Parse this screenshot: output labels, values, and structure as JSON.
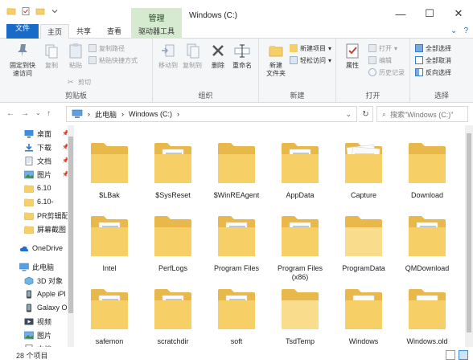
{
  "window": {
    "title": "Windows (C:)",
    "context_tab_title": "管理",
    "controls": {
      "minimize": "—",
      "maximize": "☐",
      "close": "✕"
    }
  },
  "ribbon_tabs": [
    {
      "label": "文件"
    },
    {
      "label": "主页"
    },
    {
      "label": "共享"
    },
    {
      "label": "查看"
    },
    {
      "label": "驱动器工具"
    }
  ],
  "ribbon": {
    "clipboard": {
      "label": "剪贴板",
      "pin_quick": "固定到快\n速访问",
      "copy": "复制",
      "paste": "粘贴",
      "copy_path": "复制路径",
      "paste_shortcut": "粘贴快捷方式",
      "cut": "剪切"
    },
    "organize": {
      "label": "组织",
      "move_to": "移动到",
      "copy_to": "复制到",
      "delete": "删除",
      "rename": "重命名"
    },
    "new": {
      "label": "新建",
      "new_folder": "新建\n文件夹",
      "new_item": "新建项目",
      "easy_access": "轻松访问"
    },
    "open": {
      "label": "打开",
      "properties": "属性",
      "open": "打开",
      "edit": "编辑",
      "history": "历史记录"
    },
    "select": {
      "label": "选择",
      "select_all": "全部选择",
      "select_none": "全部取消",
      "invert": "反向选择"
    }
  },
  "address": {
    "path": [
      "此电脑",
      "Windows (C:)"
    ],
    "search_placeholder": "搜索\"Windows (C:)\""
  },
  "nav_pane": [
    {
      "label": "桌面",
      "icon": "desktop-icon",
      "pinned": true
    },
    {
      "label": "下载",
      "icon": "download-icon",
      "pinned": true
    },
    {
      "label": "文档",
      "icon": "documents-icon",
      "pinned": true
    },
    {
      "label": "图片",
      "icon": "pictures-icon",
      "pinned": true
    },
    {
      "label": "6.10",
      "icon": "folder-icon",
      "pinned": false
    },
    {
      "label": "6.10-",
      "icon": "folder-icon",
      "pinned": false
    },
    {
      "label": "PR剪辑配",
      "icon": "folder-icon",
      "pinned": false
    },
    {
      "label": "屏幕截图",
      "icon": "folder-icon",
      "pinned": false
    },
    {
      "label": "OneDrive",
      "icon": "cloud-icon",
      "pinned": false
    },
    {
      "label": "此电脑",
      "icon": "computer-icon",
      "pinned": false
    },
    {
      "label": "3D 对象",
      "icon": "3d-objects-icon",
      "pinned": false
    },
    {
      "label": "Apple iPl",
      "icon": "device-icon",
      "pinned": false
    },
    {
      "label": "Galaxy O",
      "icon": "device-icon",
      "pinned": false
    },
    {
      "label": "视频",
      "icon": "video-icon",
      "pinned": false
    },
    {
      "label": "图片",
      "icon": "pictures-icon",
      "pinned": false
    },
    {
      "label": "文档",
      "icon": "documents-icon",
      "pinned": false
    }
  ],
  "files": [
    {
      "name": "$LBak",
      "style": "plain"
    },
    {
      "name": "$SysReset",
      "style": "docs"
    },
    {
      "name": "$WinREAgent",
      "style": "plain"
    },
    {
      "name": "AppData",
      "style": "docs"
    },
    {
      "name": "Capture",
      "style": "papers"
    },
    {
      "name": "Download",
      "style": "plain"
    },
    {
      "name": "Intel",
      "style": "docs"
    },
    {
      "name": "PerfLogs",
      "style": "plain"
    },
    {
      "name": "Program Files",
      "style": "docs"
    },
    {
      "name": "Program Files\n(x86)",
      "style": "docs"
    },
    {
      "name": "ProgramData",
      "style": "plain-light"
    },
    {
      "name": "QMDownload",
      "style": "docs"
    },
    {
      "name": "safemon",
      "style": "docs"
    },
    {
      "name": "scratchdir",
      "style": "docs"
    },
    {
      "name": "soft",
      "style": "docs"
    },
    {
      "name": "TsdTemp",
      "style": "plain-light"
    },
    {
      "name": "Windows",
      "style": "gear"
    },
    {
      "name": "Windows.old",
      "style": "gear"
    }
  ],
  "status": {
    "item_count": "28 个项目"
  },
  "colors": {
    "accent": "#1a6ac8",
    "folder": "#f6cf67",
    "folder_dark": "#e9b84a",
    "context_tab": "#d6ead1"
  }
}
